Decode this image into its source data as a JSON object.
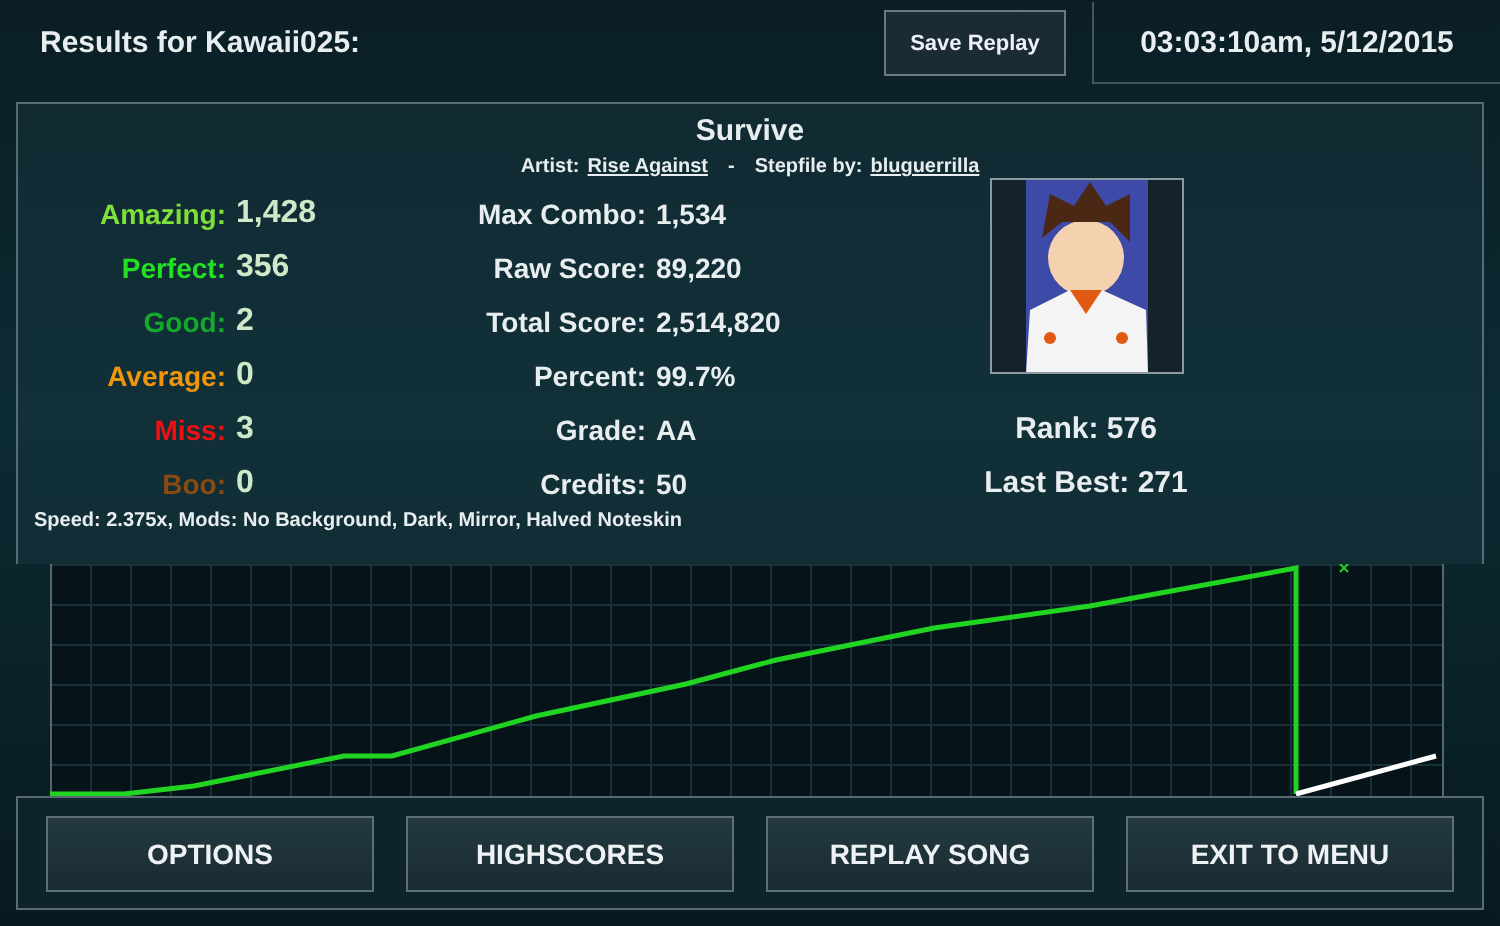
{
  "header": {
    "title": "Results for Kawaii025:",
    "save_button": "Save Replay",
    "timestamp": "03:03:10am, 5/12/2015"
  },
  "song": {
    "title": "Survive",
    "artist_label": "Artist:",
    "artist": "Rise Against",
    "separator": "-",
    "stepfile_label": "Stepfile by:",
    "stepfile_author": "bluguerrilla"
  },
  "judgments": [
    {
      "label": "Amazing:",
      "value": "1,428",
      "color": "#7fe03a"
    },
    {
      "label": "Perfect:",
      "value": "356",
      "color": "#22e022"
    },
    {
      "label": "Good:",
      "value": "2",
      "color": "#14a82c"
    },
    {
      "label": "Average:",
      "value": "0",
      "color": "#f0960a"
    },
    {
      "label": "Miss:",
      "value": "3",
      "color": "#f01010"
    },
    {
      "label": "Boo:",
      "value": "0",
      "color": "#8a4a10"
    }
  ],
  "stats": [
    {
      "label": "Max Combo:",
      "value": "1,534"
    },
    {
      "label": "Raw Score:",
      "value": "89,220"
    },
    {
      "label": "Total Score:",
      "value": "2,514,820"
    },
    {
      "label": "Percent:",
      "value": "99.7%"
    },
    {
      "label": "Grade:",
      "value": "AA"
    },
    {
      "label": "Credits:",
      "value": "50"
    }
  ],
  "player": {
    "rank": "Rank: 576",
    "last_best": "Last Best: 271"
  },
  "mods_line": "Speed: 2.375x, Mods: No Background, Dark, Mirror, Halved Noteskin",
  "buttons": [
    "OPTIONS",
    "HIGHSCORES",
    "REPLAY SONG",
    "EXIT TO MENU"
  ]
}
